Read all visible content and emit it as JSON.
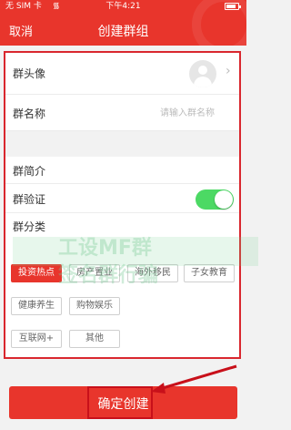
{
  "status_bar": {
    "carrier": "无 SIM 卡",
    "time": "下午4:21"
  },
  "nav": {
    "cancel": "取消",
    "title": "创建群组"
  },
  "form": {
    "avatar_label": "群头像",
    "name_label": "群名称",
    "name_placeholder": "请输入群名称",
    "name_value": "",
    "intro_label": "群简介",
    "verify_label": "群验证",
    "verify_enabled": true,
    "category_label": "群分类",
    "chevron": "›"
  },
  "tags": [
    {
      "label": "投资热点",
      "selected": true
    },
    {
      "label": "房产置业",
      "selected": false
    },
    {
      "label": "海外移民",
      "selected": false
    },
    {
      "label": "子女教育",
      "selected": false
    },
    {
      "label": "健康养生",
      "selected": false
    },
    {
      "label": "购物娱乐",
      "selected": false
    },
    {
      "label": "互联网+",
      "selected": false
    },
    {
      "label": "其他",
      "selected": false
    }
  ],
  "watermark": {
    "line1": "工设MF群",
    "line2": "签名群行骗"
  },
  "confirm_button": "确定创建",
  "colors": {
    "brand_red": "#e8352c",
    "toggle_on": "#4cd964",
    "annotation": "#d9272e"
  }
}
